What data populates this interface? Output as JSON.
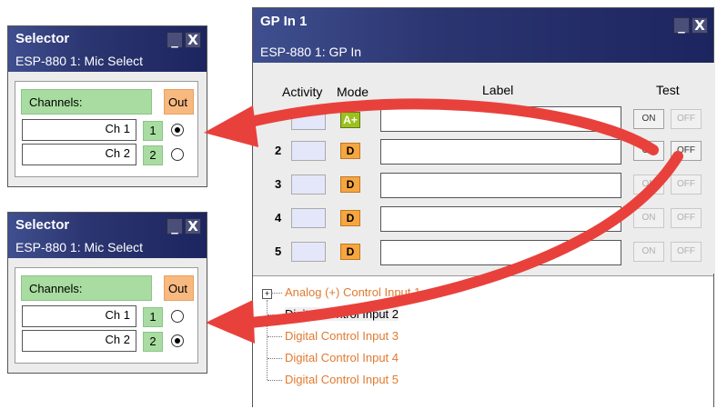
{
  "selector1": {
    "title": "Selector",
    "subtitle": "ESP-880 1: Mic Select",
    "minimize": "_",
    "close": "X",
    "channels_label": "Channels:",
    "out_label": "Out",
    "channels": [
      {
        "name": "Ch 1",
        "num": "1",
        "selected": true
      },
      {
        "name": "Ch 2",
        "num": "2",
        "selected": false
      }
    ]
  },
  "selector2": {
    "title": "Selector",
    "subtitle": "ESP-880 1: Mic Select",
    "minimize": "_",
    "close": "X",
    "channels_label": "Channels:",
    "out_label": "Out",
    "channels": [
      {
        "name": "Ch 1",
        "num": "1",
        "selected": false
      },
      {
        "name": "Ch 2",
        "num": "2",
        "selected": true
      }
    ]
  },
  "gp": {
    "title": "GP In 1",
    "subtitle": "ESP-880 1: GP In",
    "minimize": "_",
    "close": "X",
    "headers": {
      "activity": "Activity",
      "mode": "Mode",
      "label": "Label",
      "test": "Test"
    },
    "rows": [
      {
        "num": "",
        "mode": "A+",
        "on": "ON",
        "off": "OFF"
      },
      {
        "num": "2",
        "mode": "D",
        "on": "ON",
        "off": "OFF"
      },
      {
        "num": "3",
        "mode": "D",
        "on": "ON",
        "off": "OFF"
      },
      {
        "num": "4",
        "mode": "D",
        "on": "ON",
        "off": "OFF"
      },
      {
        "num": "5",
        "mode": "D",
        "on": "ON",
        "off": "OFF"
      }
    ],
    "tree": {
      "expander": "+",
      "items": [
        "Analog (+) Control Input 1",
        "Digital Control Input 2",
        "Digital Control Input 3",
        "Digital Control Input 4",
        "Digital Control Input 5"
      ],
      "selected_index": 1
    }
  },
  "colors": {
    "arrow": "#e8413c",
    "titlebar": "#2b3570",
    "green": "#a8dca0",
    "orange": "#f8b980"
  }
}
